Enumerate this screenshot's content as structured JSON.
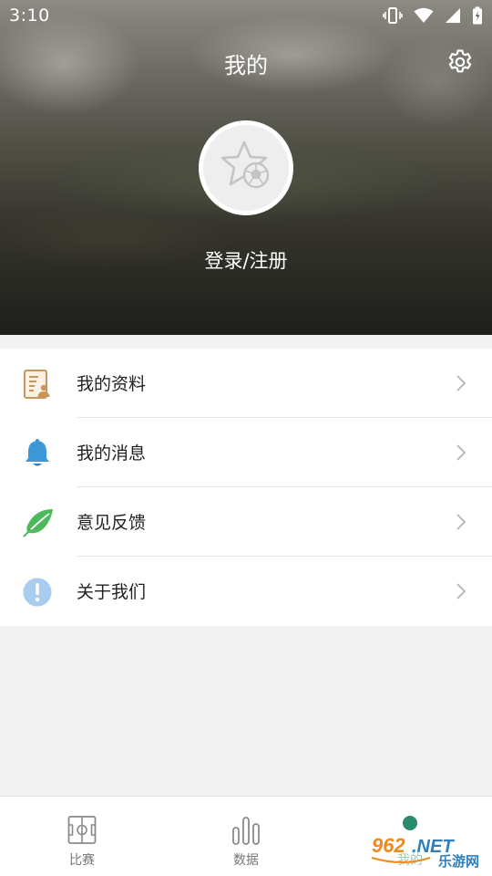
{
  "status_bar": {
    "time": "3:10",
    "icons": [
      "vibrate-icon",
      "wifi-icon",
      "signal-icon",
      "battery-icon"
    ]
  },
  "header": {
    "title": "我的",
    "settings_icon": "gear-icon"
  },
  "profile": {
    "avatar_icon": "star-soccer-ball-icon",
    "login_label": "登录/注册"
  },
  "menu": {
    "items": [
      {
        "label": "我的资料",
        "icon": "profile-document-icon",
        "icon_color": "#c8955a"
      },
      {
        "label": "我的消息",
        "icon": "bell-icon",
        "icon_color": "#3d98d8"
      },
      {
        "label": "意见反馈",
        "icon": "feather-icon",
        "icon_color": "#4cba5a"
      },
      {
        "label": "关于我们",
        "icon": "info-icon",
        "icon_color": "#a9cdf0"
      }
    ]
  },
  "bottom_nav": {
    "items": [
      {
        "label": "比赛",
        "icon": "soccer-field-icon",
        "active": false
      },
      {
        "label": "数据",
        "icon": "bar-chart-icon",
        "active": false
      },
      {
        "label": "我的",
        "icon": "user-icon",
        "active": true
      }
    ]
  },
  "watermark": {
    "text_top": "962.NET",
    "text_bottom": "乐游网"
  },
  "colors": {
    "accent": "#2e8b57",
    "text_primary": "#222222",
    "text_secondary": "#777777",
    "background": "#f2f2f2"
  }
}
